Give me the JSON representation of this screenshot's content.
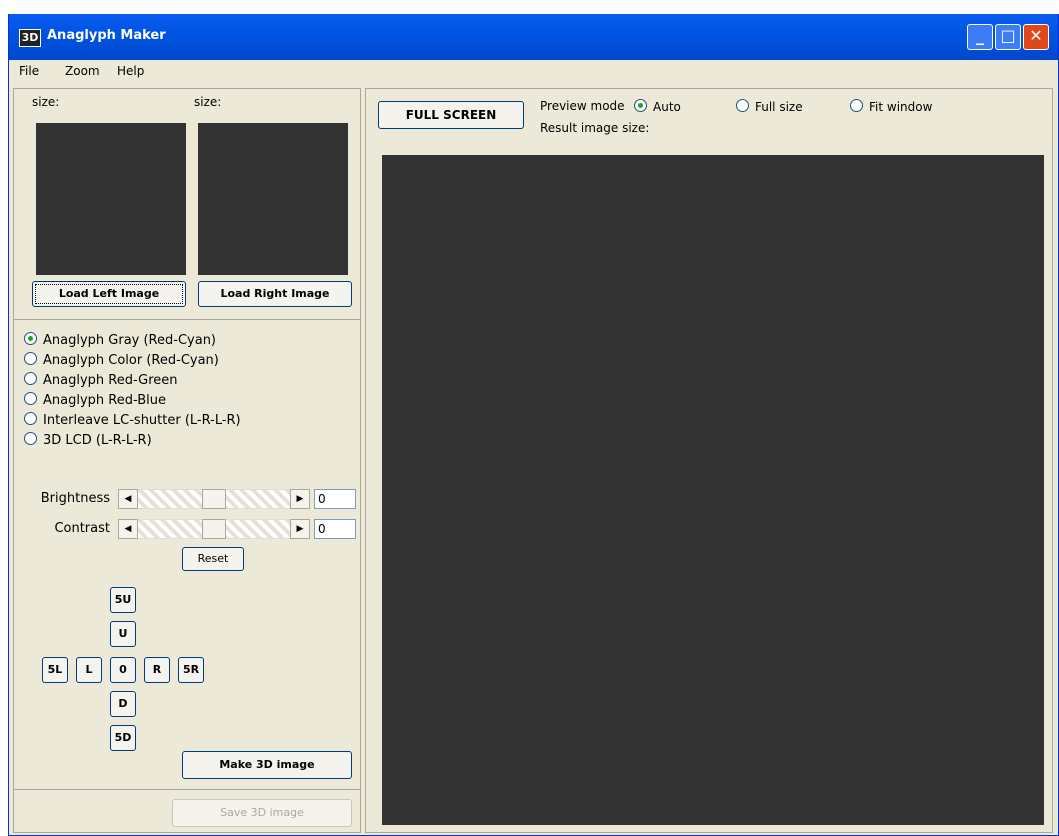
{
  "window": {
    "title": "Anaglyph Maker",
    "icon_text": "3D",
    "controls": {
      "minimize": "_",
      "maximize": "□",
      "close": "✕"
    }
  },
  "menu": {
    "items": [
      "File",
      "Zoom",
      "Help"
    ]
  },
  "left": {
    "left_size_label": "size:",
    "right_size_label": "size:",
    "load_left_label": "Load Left Image",
    "load_right_label": "Load Right Image",
    "modes": [
      {
        "label": "Anaglyph Gray (Red-Cyan)",
        "selected": true
      },
      {
        "label": "Anaglyph Color (Red-Cyan)",
        "selected": false
      },
      {
        "label": "Anaglyph Red-Green",
        "selected": false
      },
      {
        "label": "Anaglyph Red-Blue",
        "selected": false
      },
      {
        "label": "Interleave LC-shutter (L-R-L-R)",
        "selected": false
      },
      {
        "label": "3D LCD (L-R-L-R)",
        "selected": false
      }
    ],
    "brightness": {
      "label": "Brightness",
      "value": "0",
      "level": 0.5
    },
    "contrast": {
      "label": "Contrast",
      "value": "0",
      "level": 0.5
    },
    "reset_label": "Reset",
    "pad": {
      "up5": "5U",
      "up1": "U",
      "left5": "5L",
      "left1": "L",
      "center": "0",
      "right1": "R",
      "right5": "5R",
      "down1": "D",
      "down5": "5D"
    },
    "make_label": "Make 3D image",
    "save_label": "Save 3D image"
  },
  "right": {
    "fullscreen_label": "FULL SCREEN",
    "preview_mode_label": "Preview mode",
    "preview_options": [
      {
        "label": "Auto",
        "selected": true
      },
      {
        "label": "Full size",
        "selected": false
      },
      {
        "label": "Fit window",
        "selected": false
      }
    ],
    "result_size_label": "Result image size:"
  }
}
